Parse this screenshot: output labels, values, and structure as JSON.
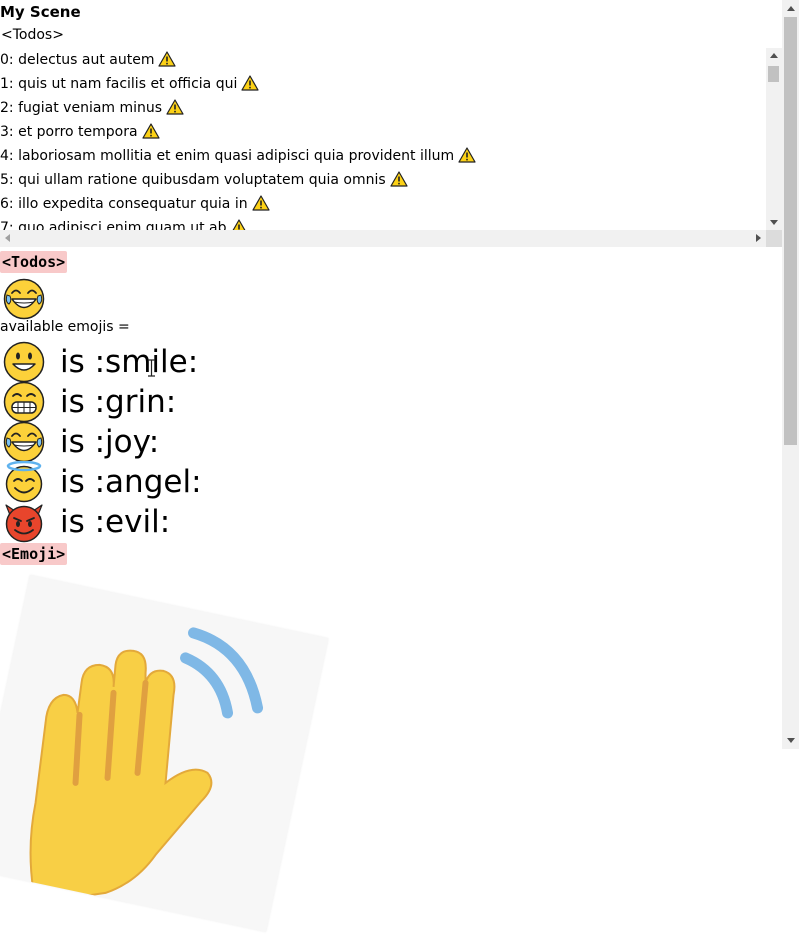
{
  "scene": {
    "title": "My Scene"
  },
  "todos": {
    "open_tag": "<Todos>",
    "items": [
      {
        "text": "0: delectus aut autem",
        "icon": "warning-icon"
      },
      {
        "text": "1: quis ut nam facilis et officia qui",
        "icon": "warning-icon"
      },
      {
        "text": "2: fugiat veniam minus",
        "icon": "warning-icon"
      },
      {
        "text": "3: et porro tempora",
        "icon": "warning-icon"
      },
      {
        "text": "4: laboriosam mollitia et enim quasi adipisci quia provident illum",
        "icon": "warning-icon"
      },
      {
        "text": "5: qui ullam ratione quibusdam voluptatem quia omnis",
        "icon": "warning-icon"
      },
      {
        "text": "6: illo expedita consequatur quia in",
        "icon": "warning-icon"
      },
      {
        "text": "7: quo adipisci enim quam ut ab",
        "icon": "warning-icon"
      }
    ],
    "component_label": "<Todos>"
  },
  "emoji": {
    "current": "joy",
    "available_label": "available emojis =",
    "list": [
      {
        "name": "smile",
        "label": "is :smile:"
      },
      {
        "name": "grin",
        "label": "is :grin:"
      },
      {
        "name": "joy",
        "label": "is :joy:"
      },
      {
        "name": "angel",
        "label": "is :angel:"
      },
      {
        "name": "evil",
        "label": "is :evil:"
      }
    ],
    "component_label": "<Emoji>"
  },
  "colors": {
    "tag_bg": "#f8c9c9",
    "emoji_yellow": "#fcd13a",
    "evil_red": "#e8452c",
    "warning_yellow": "#fcd116"
  },
  "image": {
    "icon": "waving-hand-icon"
  }
}
